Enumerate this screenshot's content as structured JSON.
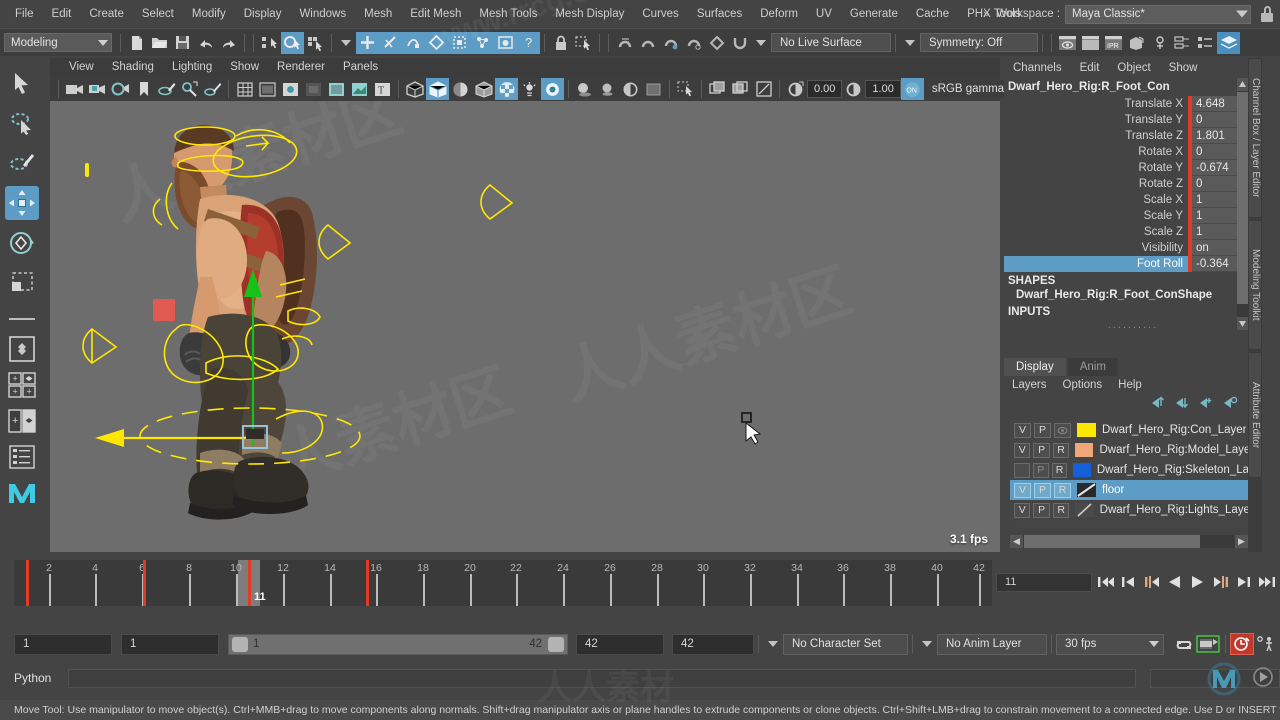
{
  "menubar": {
    "items": [
      "File",
      "Edit",
      "Create",
      "Select",
      "Modify",
      "Display",
      "Windows",
      "Mesh",
      "Edit Mesh",
      "Mesh Tools",
      "Mesh Display",
      "Curves",
      "Surfaces",
      "Deform",
      "UV",
      "Generate",
      "Cache",
      "PHX Tools"
    ],
    "chevrons": "»",
    "workspace_label": "Workspace :",
    "workspace_value": "Maya Classic*"
  },
  "toolbar": {
    "menuset": "Modeling",
    "live_surface": "No Live Surface",
    "symmetry": "Symmetry: Off",
    "input1": "0.00",
    "input2": "1.00"
  },
  "viewport": {
    "menu": [
      "View",
      "Shading",
      "Lighting",
      "Show",
      "Renderer",
      "Panels"
    ],
    "exposure": "0.00",
    "gamma": "1.00",
    "colorspace": "sRGB gamma",
    "fps": "3.1 fps"
  },
  "channelbox": {
    "menu": [
      "Channels",
      "Edit",
      "Object",
      "Show"
    ],
    "node": "Dwarf_Hero_Rig:R_Foot_Con",
    "attributes": [
      {
        "name": "Translate X",
        "value": "4.648",
        "selected": false
      },
      {
        "name": "Translate Y",
        "value": "0",
        "selected": false
      },
      {
        "name": "Translate Z",
        "value": "1.801",
        "selected": false
      },
      {
        "name": "Rotate X",
        "value": "0",
        "selected": false
      },
      {
        "name": "Rotate Y",
        "value": "-0.674",
        "selected": false
      },
      {
        "name": "Rotate Z",
        "value": "0",
        "selected": false
      },
      {
        "name": "Scale X",
        "value": "1",
        "selected": false
      },
      {
        "name": "Scale Y",
        "value": "1",
        "selected": false
      },
      {
        "name": "Scale Z",
        "value": "1",
        "selected": false
      },
      {
        "name": "Visibility",
        "value": "on",
        "selected": false
      },
      {
        "name": "Foot Roll",
        "value": "-0.364",
        "selected": true
      }
    ],
    "shapes_label": "SHAPES",
    "shape_name": "Dwarf_Hero_Rig:R_Foot_ConShape",
    "inputs_label": "INPUTS"
  },
  "sidetabs": [
    {
      "label": "Channel Box / Layer Editor"
    },
    {
      "label": "Modeling Toolkit"
    },
    {
      "label": "Attribute Editor"
    }
  ],
  "layereditor": {
    "tabs": [
      {
        "label": "Display",
        "active": true
      },
      {
        "label": "Anim",
        "active": false
      }
    ],
    "menu": [
      "Layers",
      "Options",
      "Help"
    ],
    "layers": [
      {
        "v": "V",
        "p": "P",
        "r": "",
        "color": "#ffe800",
        "name": "Dwarf_Hero_Rig:Con_Layer",
        "selected": false,
        "template": true
      },
      {
        "v": "V",
        "p": "P",
        "r": "R",
        "color": "#efa778",
        "name": "Dwarf_Hero_Rig:Model_Layer",
        "selected": false,
        "template": false
      },
      {
        "v": "",
        "p": "P",
        "r": "R",
        "color": "#1560d8",
        "name": "Dwarf_Hero_Rig:Skeleton_Laye",
        "selected": false,
        "template": false
      },
      {
        "v": "V",
        "p": "P",
        "r": "R",
        "color": "#2a2a2a",
        "name": "floor",
        "selected": true,
        "template": false
      },
      {
        "v": "V",
        "p": "P",
        "r": "R",
        "color": "#5a5a5a",
        "name": "Dwarf_Hero_Rig:Lights_Layer",
        "selected": false,
        "template": false
      }
    ]
  },
  "timeline": {
    "labels": [
      "2",
      "4",
      "6",
      "8",
      "10",
      "12",
      "14",
      "16",
      "18",
      "20",
      "22",
      "24",
      "26",
      "28",
      "30",
      "32",
      "34",
      "36",
      "38",
      "40",
      "42"
    ],
    "start": 1,
    "end": 42,
    "current_frame": "11",
    "keyframes": [
      1,
      6,
      11,
      16
    ],
    "current_field": "11"
  },
  "rangeslider": {
    "anim_start": "1",
    "range_start": "1",
    "bar_start": "1",
    "bar_end": "42",
    "range_end": "42",
    "anim_end": "42",
    "character_set": "No Character Set",
    "anim_layer": "No Anim Layer",
    "fps": "30 fps"
  },
  "commandline": {
    "language": "Python",
    "value": "",
    "placeholder": ""
  },
  "helpline": {
    "text": "Move Tool: Use manipulator to move object(s). Ctrl+MMB+drag to move components along normals. Shift+drag manipulator axis or plane handles to extrude components or clone objects. Ctrl+Shift+LMB+drag to constrain movement to a connected edge. Use D or INSERT to change"
  },
  "colors": {
    "accent_blue": "#5d9cc4",
    "key_red": "#e33a22",
    "control_yellow": "#ffe800",
    "axis_green": "#17c117",
    "viewport_bg": "#6d6d6d"
  },
  "watermarks": {
    "site": "www.rrcg.cn",
    "community": "人人素材"
  }
}
